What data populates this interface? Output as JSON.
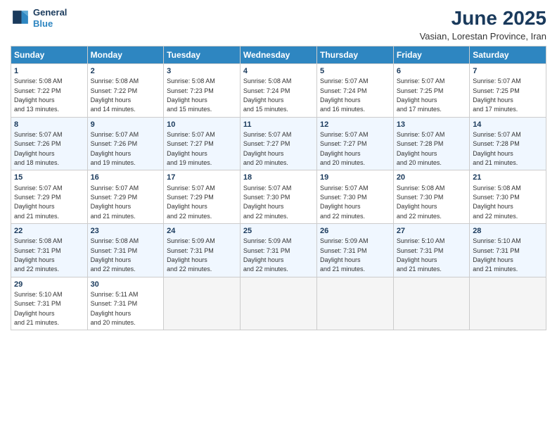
{
  "header": {
    "logo_line1": "General",
    "logo_line2": "Blue",
    "title": "June 2025",
    "subtitle": "Vasian, Lorestan Province, Iran"
  },
  "calendar": {
    "days_of_week": [
      "Sunday",
      "Monday",
      "Tuesday",
      "Wednesday",
      "Thursday",
      "Friday",
      "Saturday"
    ],
    "weeks": [
      [
        {
          "day": "1",
          "sunrise": "5:08 AM",
          "sunset": "7:22 PM",
          "daylight": "14 hours and 13 minutes."
        },
        {
          "day": "2",
          "sunrise": "5:08 AM",
          "sunset": "7:22 PM",
          "daylight": "14 hours and 14 minutes."
        },
        {
          "day": "3",
          "sunrise": "5:08 AM",
          "sunset": "7:23 PM",
          "daylight": "14 hours and 15 minutes."
        },
        {
          "day": "4",
          "sunrise": "5:08 AM",
          "sunset": "7:24 PM",
          "daylight": "14 hours and 15 minutes."
        },
        {
          "day": "5",
          "sunrise": "5:07 AM",
          "sunset": "7:24 PM",
          "daylight": "14 hours and 16 minutes."
        },
        {
          "day": "6",
          "sunrise": "5:07 AM",
          "sunset": "7:25 PM",
          "daylight": "14 hours and 17 minutes."
        },
        {
          "day": "7",
          "sunrise": "5:07 AM",
          "sunset": "7:25 PM",
          "daylight": "14 hours and 17 minutes."
        }
      ],
      [
        {
          "day": "8",
          "sunrise": "5:07 AM",
          "sunset": "7:26 PM",
          "daylight": "14 hours and 18 minutes."
        },
        {
          "day": "9",
          "sunrise": "5:07 AM",
          "sunset": "7:26 PM",
          "daylight": "14 hours and 19 minutes."
        },
        {
          "day": "10",
          "sunrise": "5:07 AM",
          "sunset": "7:27 PM",
          "daylight": "14 hours and 19 minutes."
        },
        {
          "day": "11",
          "sunrise": "5:07 AM",
          "sunset": "7:27 PM",
          "daylight": "14 hours and 20 minutes."
        },
        {
          "day": "12",
          "sunrise": "5:07 AM",
          "sunset": "7:27 PM",
          "daylight": "14 hours and 20 minutes."
        },
        {
          "day": "13",
          "sunrise": "5:07 AM",
          "sunset": "7:28 PM",
          "daylight": "14 hours and 20 minutes."
        },
        {
          "day": "14",
          "sunrise": "5:07 AM",
          "sunset": "7:28 PM",
          "daylight": "14 hours and 21 minutes."
        }
      ],
      [
        {
          "day": "15",
          "sunrise": "5:07 AM",
          "sunset": "7:29 PM",
          "daylight": "14 hours and 21 minutes."
        },
        {
          "day": "16",
          "sunrise": "5:07 AM",
          "sunset": "7:29 PM",
          "daylight": "14 hours and 21 minutes."
        },
        {
          "day": "17",
          "sunrise": "5:07 AM",
          "sunset": "7:29 PM",
          "daylight": "14 hours and 22 minutes."
        },
        {
          "day": "18",
          "sunrise": "5:07 AM",
          "sunset": "7:30 PM",
          "daylight": "14 hours and 22 minutes."
        },
        {
          "day": "19",
          "sunrise": "5:07 AM",
          "sunset": "7:30 PM",
          "daylight": "14 hours and 22 minutes."
        },
        {
          "day": "20",
          "sunrise": "5:08 AM",
          "sunset": "7:30 PM",
          "daylight": "14 hours and 22 minutes."
        },
        {
          "day": "21",
          "sunrise": "5:08 AM",
          "sunset": "7:30 PM",
          "daylight": "14 hours and 22 minutes."
        }
      ],
      [
        {
          "day": "22",
          "sunrise": "5:08 AM",
          "sunset": "7:31 PM",
          "daylight": "14 hours and 22 minutes."
        },
        {
          "day": "23",
          "sunrise": "5:08 AM",
          "sunset": "7:31 PM",
          "daylight": "14 hours and 22 minutes."
        },
        {
          "day": "24",
          "sunrise": "5:09 AM",
          "sunset": "7:31 PM",
          "daylight": "14 hours and 22 minutes."
        },
        {
          "day": "25",
          "sunrise": "5:09 AM",
          "sunset": "7:31 PM",
          "daylight": "14 hours and 22 minutes."
        },
        {
          "day": "26",
          "sunrise": "5:09 AM",
          "sunset": "7:31 PM",
          "daylight": "14 hours and 21 minutes."
        },
        {
          "day": "27",
          "sunrise": "5:10 AM",
          "sunset": "7:31 PM",
          "daylight": "14 hours and 21 minutes."
        },
        {
          "day": "28",
          "sunrise": "5:10 AM",
          "sunset": "7:31 PM",
          "daylight": "14 hours and 21 minutes."
        }
      ],
      [
        {
          "day": "29",
          "sunrise": "5:10 AM",
          "sunset": "7:31 PM",
          "daylight": "14 hours and 21 minutes."
        },
        {
          "day": "30",
          "sunrise": "5:11 AM",
          "sunset": "7:31 PM",
          "daylight": "14 hours and 20 minutes."
        },
        null,
        null,
        null,
        null,
        null
      ]
    ]
  }
}
